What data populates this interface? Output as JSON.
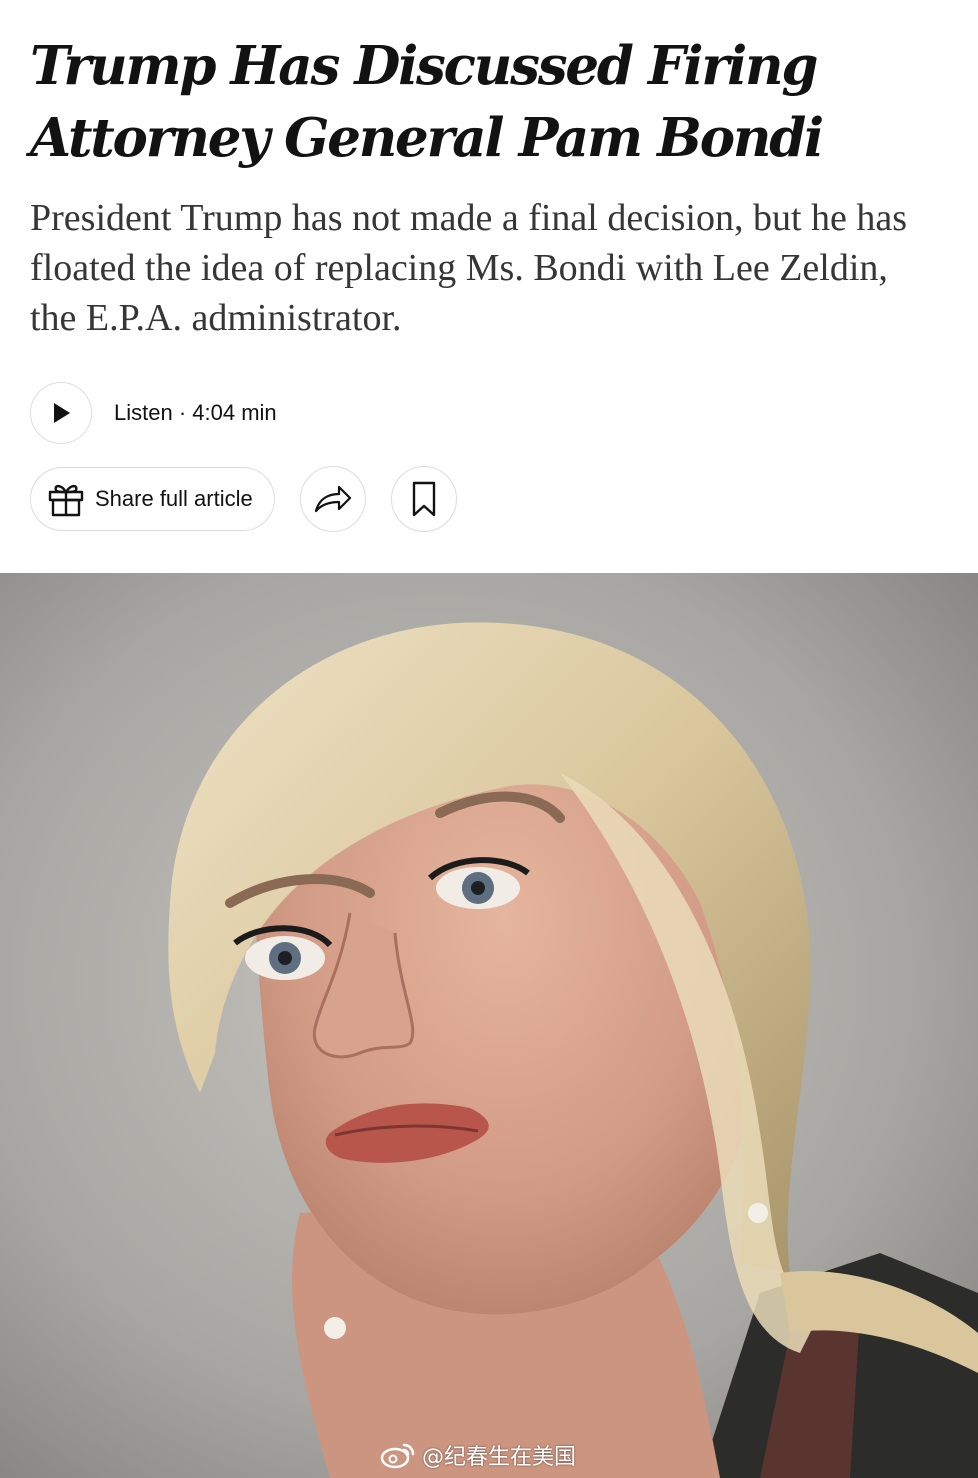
{
  "article": {
    "headline": "Trump Has Discussed Firing Attorney General Pam Bondi",
    "summary": "President Trump has not made a final decision, but he has floated the idea of replacing Ms. Bondi with Lee Zeldin, the E.P.A. administrator."
  },
  "audio": {
    "listen_label": "Listen · 4:04 min",
    "play_icon": "play-icon"
  },
  "actions": {
    "share_label": "Share full article",
    "share_icon": "gift-icon",
    "forward_icon": "share-arrow-icon",
    "bookmark_icon": "bookmark-icon"
  },
  "photo": {
    "subject": "portrait-photo"
  },
  "watermark": {
    "text": "@纪春生在美国",
    "icon": "weibo-icon"
  }
}
